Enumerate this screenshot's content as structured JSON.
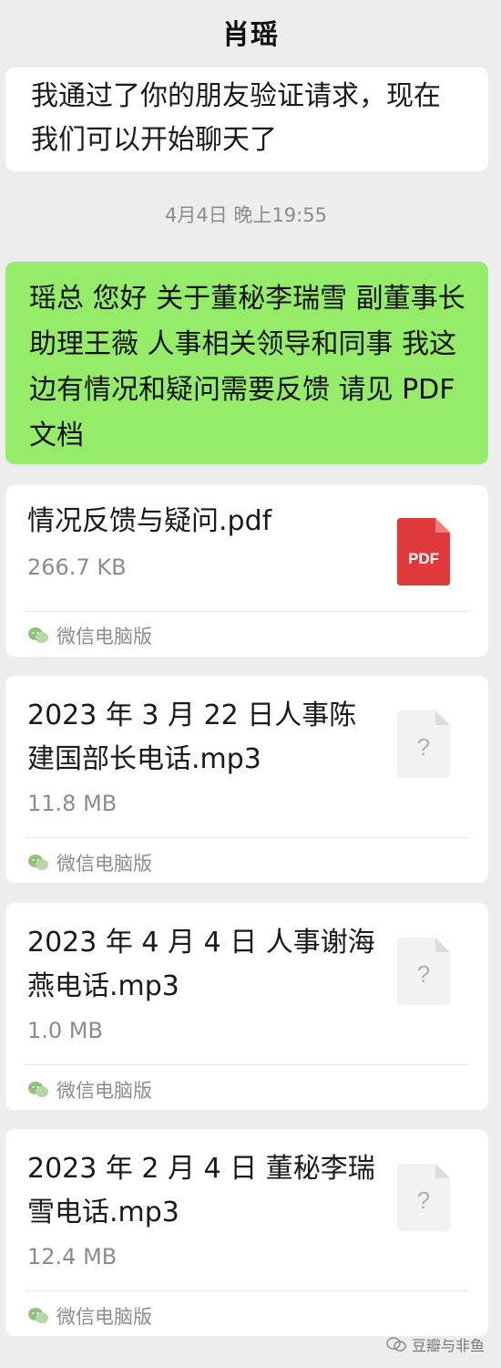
{
  "header": {
    "title": "肖瑶"
  },
  "messages": {
    "system_msg": "我通过了你的朋友验证请求，现在我们可以开始聊天了",
    "timestamp": "4月4日 晚上19:55",
    "sent_text": "瑶总 您好 关于董秘李瑞雪 副董事长助理王薇 人事相关领导和同事 我这边有情况和疑问需要反馈 请见 PDF 文档"
  },
  "files": [
    {
      "name": "情况反馈与疑问.pdf",
      "size": "266.7 KB",
      "source": "微信电脑版",
      "icon": "pdf-icon",
      "icon_label": "PDF",
      "icon_color": "#e0393b"
    },
    {
      "name": "2023 年 3 月 22 日人事陈建国部长电话.mp3",
      "size": "11.8 MB",
      "source": "微信电脑版",
      "icon": "unknown-file-icon",
      "icon_label": "?"
    },
    {
      "name": "2023 年 4 月 4 日 人事谢海燕电话.mp3",
      "size": "1.0 MB",
      "source": "微信电脑版",
      "icon": "unknown-file-icon",
      "icon_label": "?"
    },
    {
      "name": "2023 年 2 月 4 日 董秘李瑞雪电话.mp3",
      "size": "12.4 MB",
      "source": "微信电脑版",
      "icon": "unknown-file-icon",
      "icon_label": "?"
    }
  ],
  "watermark": {
    "text": "豆瓣与非鱼"
  },
  "colors": {
    "background": "#ededed",
    "sent_bubble": "#95ec69",
    "wechat_green": "#07c160"
  }
}
